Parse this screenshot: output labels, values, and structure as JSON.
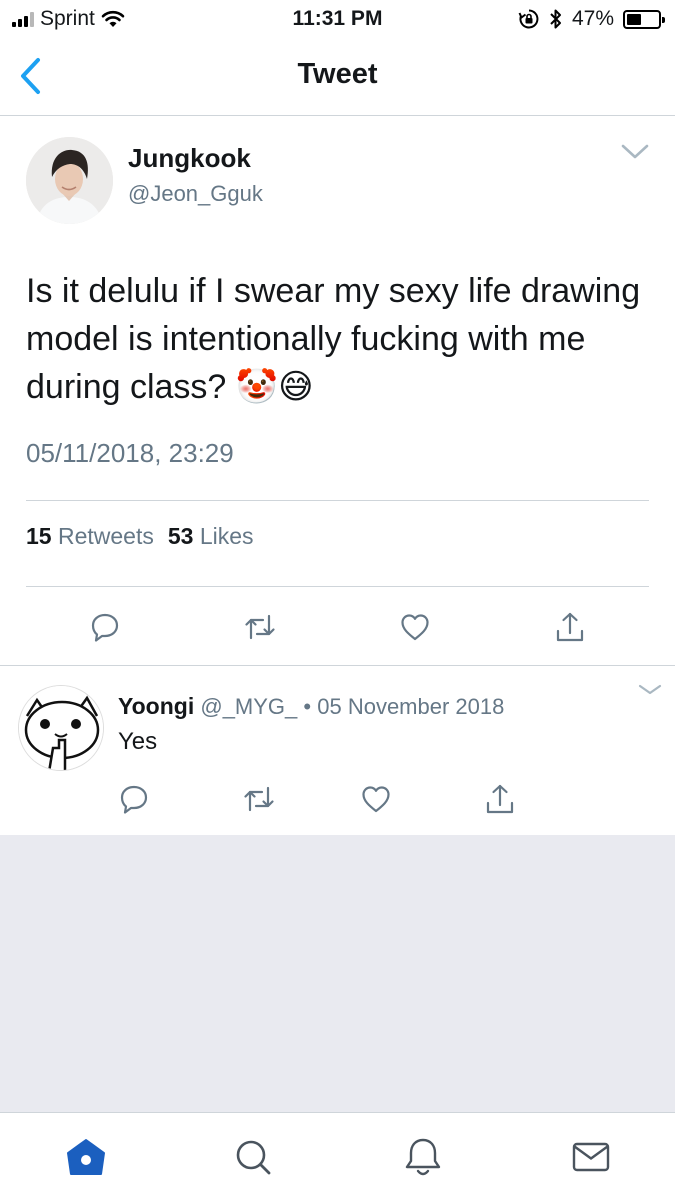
{
  "status_bar": {
    "carrier": "Sprint",
    "time": "11:31 PM",
    "battery_percent": "47%",
    "battery_level": 0.47,
    "icons": [
      "signal-icon",
      "wifi-icon",
      "rotation-lock-icon",
      "bluetooth-icon",
      "battery-icon"
    ]
  },
  "nav": {
    "title": "Tweet",
    "back_icon": "chevron-left-icon"
  },
  "tweet": {
    "author_name": "Jungkook",
    "author_handle": "@Jeon_Gguk",
    "text": "Is it delulu if I swear my sexy life drawing model is intentionally fucking with me during class? 🤡😅",
    "timestamp": "05/11/2018, 23:29",
    "retweets_count": "15",
    "retweets_label": "Retweets",
    "likes_count": "53",
    "likes_label": "Likes",
    "actions": [
      "reply-icon",
      "retweet-icon",
      "like-icon",
      "share-icon"
    ]
  },
  "reply": {
    "author_name": "Yoongi",
    "author_handle": "@_MYG_",
    "separator": "•",
    "date": "05 November 2018",
    "text": "Yes",
    "actions": [
      "reply-icon",
      "retweet-icon",
      "like-icon",
      "share-icon"
    ]
  },
  "tab_bar": {
    "tabs": [
      "home-icon",
      "search-icon",
      "notifications-icon",
      "messages-icon"
    ],
    "active": "home-icon"
  },
  "colors": {
    "accent": "#1da1f2",
    "tab_active": "#1b5fbf",
    "secondary_text": "#657786",
    "divider": "#cfd5da",
    "empty_background": "#e9eaf0"
  }
}
